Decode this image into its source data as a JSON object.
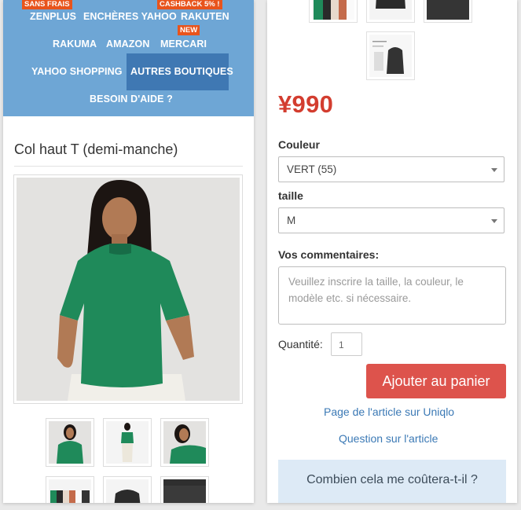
{
  "nav": {
    "badges": {
      "sans_frais": "SANS FRAIS",
      "cashback": "CASHBACK 5% !",
      "new": "NEW"
    },
    "items": {
      "zenplus": "ZENPLUS",
      "encheres": "ENCHÈRES YAHOO",
      "rakuten": "RAKUTEN",
      "rakuma": "RAKUMA",
      "amazon": "AMAZON",
      "mercari": "MERCARI",
      "yahoo_shopping": "YAHOO SHOPPING",
      "autres": "AUTRES BOUTIQUES",
      "aide": "BESOIN D'AIDE ?"
    },
    "colors": {
      "bar": "#6ea6d5",
      "active": "#3f78b3",
      "badge": "#e8541c"
    }
  },
  "product": {
    "title": "Col haut T (demi-manche)",
    "price": "¥990",
    "color_label": "Couleur",
    "color_value": "VERT (55)",
    "size_label": "taille",
    "size_value": "M",
    "comments_label": "Vos commentaires:",
    "comments_placeholder": "Veuillez inscrire la taille, la couleur, le modèle etc. si nécessaire.",
    "quantity_label": "Quantité:",
    "quantity_value": "1",
    "add_to_cart": "Ajouter au panier",
    "link_uniqlo": "Page de l'article sur Uniqlo",
    "link_question": "Question sur l'article",
    "cost_question": "Combien cela me coûtera-t-il ?"
  },
  "colors": {
    "price": "#d33d2f",
    "cart_button": "#dd534c",
    "link": "#3b79b5",
    "cost_box": "#ddeaf6",
    "shirt": "#1f8a5a"
  }
}
